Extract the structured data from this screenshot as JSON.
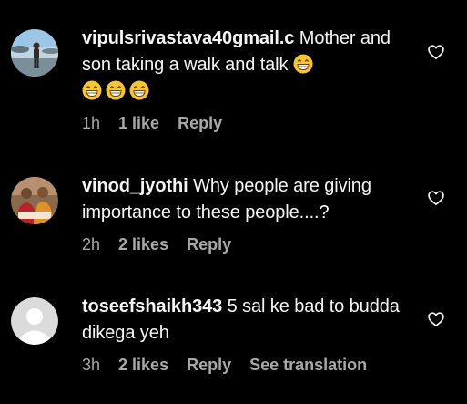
{
  "comments": [
    {
      "avatar": "avatar-photo-person-lakeside",
      "username": "vipulsrivastava40gmail.c",
      "text": "Mother and son taking a walk and talk",
      "emoji_count": 4,
      "emoji_name": "grinning-face-emoji",
      "time": "1h",
      "likes": "1 like",
      "reply": "Reply",
      "translation": ""
    },
    {
      "avatar": "avatar-photo-couple",
      "username": "vinod_jyothi",
      "text": "Why people are giving importance to these people....?",
      "time": "2h",
      "likes": "2 likes",
      "reply": "Reply",
      "translation": ""
    },
    {
      "avatar": "default-avatar",
      "username": "toseefshaikh343",
      "text": "5 sal ke bad to budda dikega yeh",
      "time": "3h",
      "likes": "2 likes",
      "reply": "Reply",
      "translation": "See translation"
    }
  ],
  "icons": {
    "like": "heart-icon"
  },
  "colors": {
    "background": "#000000",
    "text": "#f5f5f5",
    "meta": "#a8a8a8",
    "emoji": "#f7c531"
  }
}
